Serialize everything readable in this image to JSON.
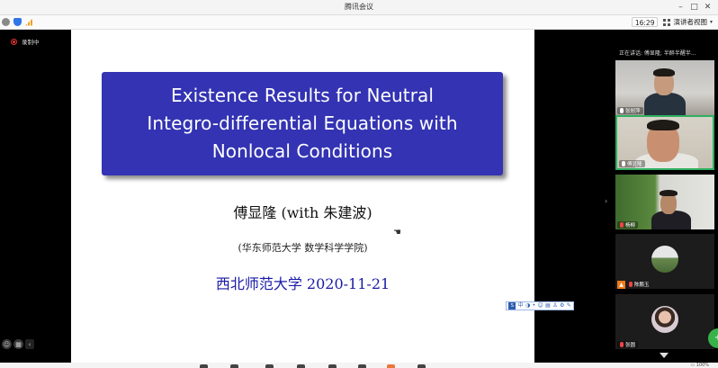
{
  "window": {
    "title": "腾讯会议",
    "controls": [
      "–",
      "□",
      "✕"
    ]
  },
  "toolbar": {
    "time": "16:29",
    "view_label": "演讲者视图",
    "view_arrow": "▾"
  },
  "recording": {
    "label": "录制中"
  },
  "slide": {
    "title_lines": [
      "Existence Results for Neutral",
      "Integro-differential Equations with",
      "Nonlocal Conditions"
    ],
    "author": "傅显隆 (with 朱建波)",
    "affiliation": "(华东师范大学 数学科学学院)",
    "venue": "西北师范大学",
    "date": "2020-11-21"
  },
  "mini_toolbar": {
    "items": [
      "中",
      "◑",
      "•",
      "☺",
      "▤",
      "♙",
      "⚙",
      "✎"
    ]
  },
  "participants": {
    "speaking": "正在讲话: 傅显隆; 半醉半醒半...",
    "tiles": [
      {
        "name": "张旭萍",
        "muted": false
      },
      {
        "name": "傅显隆",
        "muted": false
      },
      {
        "name": "杨柳",
        "muted": true
      },
      {
        "name": "陈鹏玉",
        "muted": true
      },
      {
        "name": "张圆",
        "muted": true
      }
    ]
  },
  "bottom": {
    "right_text": "▭ 100%"
  },
  "colors": {
    "slide_title_bg": "#3333b3",
    "venue_blue": "#1a1aa8",
    "active_speaker": "#30b060",
    "record_red": "#e33"
  }
}
